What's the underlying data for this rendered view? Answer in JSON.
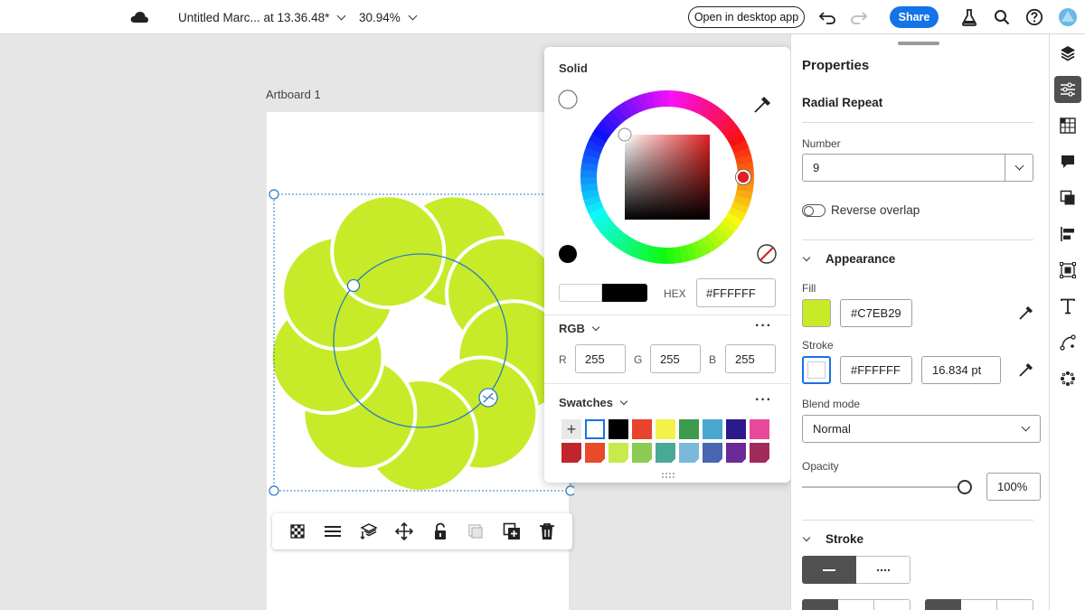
{
  "topbar": {
    "document_title": "Untitled Marc... at 13.36.48*",
    "zoom": "30.94%",
    "open_desktop_label": "Open in desktop app",
    "share_label": "Share"
  },
  "canvas": {
    "artboard_label": "Artboard 1",
    "shape_fill": "#C7EB29"
  },
  "color_picker": {
    "mode_label": "Solid",
    "hex_label": "HEX",
    "hex_value": "#FFFFFF",
    "rgb_section_label": "RGB",
    "r_label": "R",
    "r_value": "255",
    "g_label": "G",
    "g_value": "255",
    "b_label": "B",
    "b_value": "255",
    "swatches_label": "Swatches",
    "add_swatch_symbol": "+",
    "swatches_row1": [
      "#FFFFFF",
      "#000000",
      "#E8432C",
      "#F2F24A",
      "#3E9A4C",
      "#4AA8D0",
      "#2B1A8C",
      "#E8489A"
    ],
    "swatches_row2": [
      "#C0252C",
      "#E84A2C",
      "#C7EB4A",
      "#8CCB52",
      "#4AA896",
      "#7AB8DC",
      "#4A66B0",
      "#6A2A9A",
      "#A02A5C"
    ]
  },
  "properties": {
    "title": "Properties",
    "effect_name": "Radial Repeat",
    "number_label": "Number",
    "number_value": "9",
    "reverse_overlap_label": "Reverse overlap",
    "appearance_label": "Appearance",
    "fill_label": "Fill",
    "fill_hex": "#C7EB29",
    "stroke_label": "Stroke",
    "stroke_hex": "#FFFFFF",
    "stroke_weight": "16.834 pt",
    "blend_mode_label": "Blend mode",
    "blend_mode_value": "Normal",
    "opacity_label": "Opacity",
    "opacity_value": "100%",
    "stroke_section_label": "Stroke"
  },
  "colors": {
    "accent": "#1473E6",
    "panel_active": "#505050"
  }
}
